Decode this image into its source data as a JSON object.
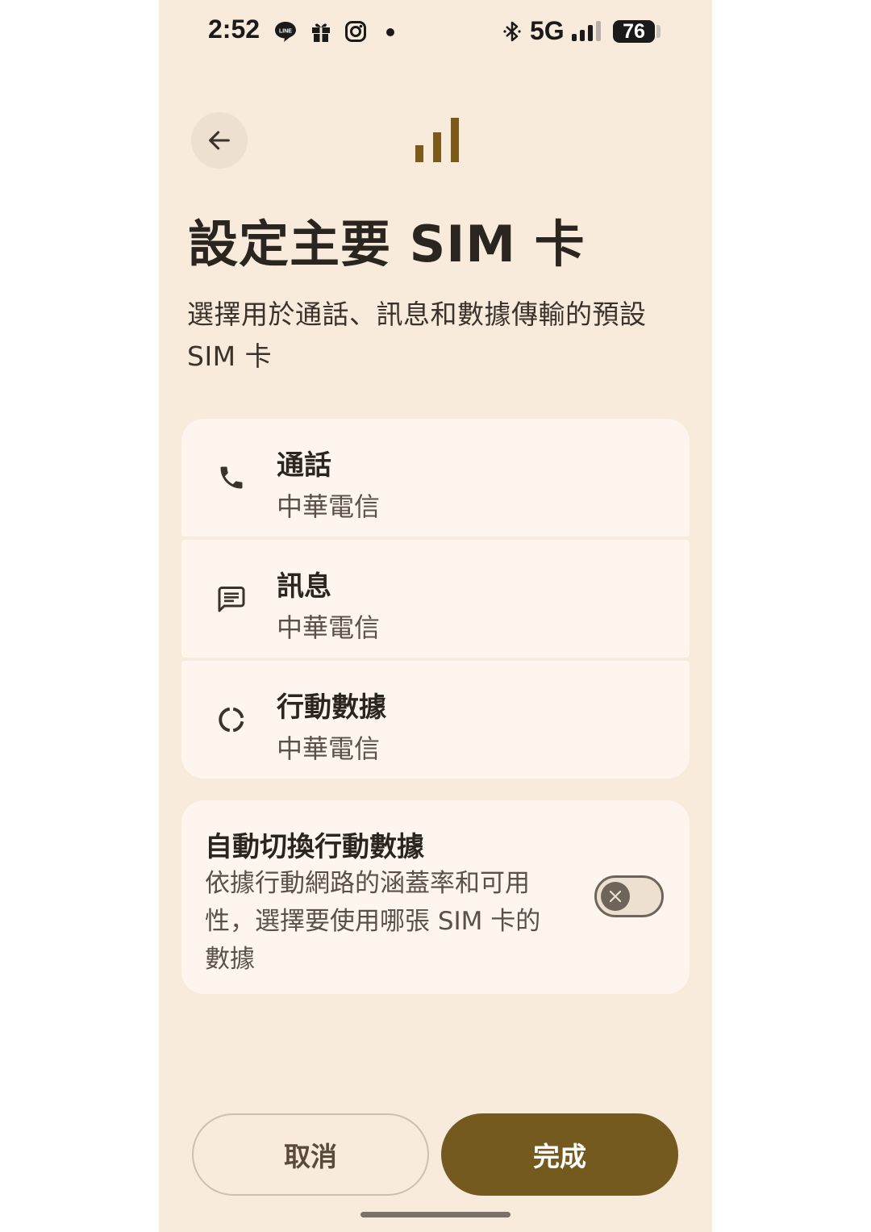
{
  "status_bar": {
    "time": "2:52",
    "network": "5G",
    "battery": "76",
    "icons": [
      "line-icon",
      "gift-icon",
      "instagram-icon",
      "dot-icon",
      "bluetooth-icon",
      "cell-signal-icon",
      "battery-icon"
    ]
  },
  "header": {
    "back_icon": "arrow-left-icon",
    "hero_icon": "signal-bars-icon",
    "title": "設定主要 SIM 卡",
    "subtitle": "選擇用於通話、訊息和數據傳輸的預設 SIM 卡"
  },
  "preferences": [
    {
      "title": "通話",
      "value": "中華電信",
      "icon": "phone-icon"
    },
    {
      "title": "訊息",
      "value": "中華電信",
      "icon": "message-icon"
    },
    {
      "title": "行動數據",
      "value": "中華電信",
      "icon": "data-usage-icon"
    }
  ],
  "auto_switch": {
    "title": "自動切換行動數據",
    "description": "依據行動網路的涵蓋率和可用性，選擇要使用哪張 SIM 卡的數據",
    "enabled": false,
    "icon": "close-icon"
  },
  "buttons": {
    "cancel": "取消",
    "done": "完成"
  },
  "colors": {
    "background": "#f8ebdc",
    "card": "#fdf5ee",
    "accent": "#755a1f",
    "text": "#2b2520"
  }
}
